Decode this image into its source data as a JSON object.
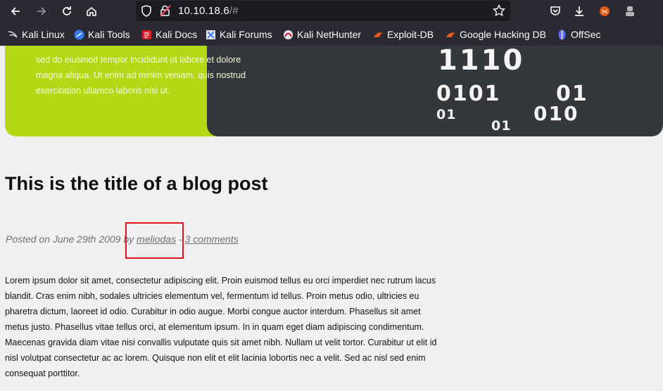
{
  "browser": {
    "url_host": "10.10.18.6",
    "url_path": "/#",
    "nav_icons": [
      "back-icon",
      "forward-icon",
      "reload-icon",
      "home-icon"
    ],
    "url_icons": [
      "shield-icon",
      "insecure-lock-icon",
      "bookmark-star-icon"
    ],
    "toolbar_icons": [
      "pocket-icon",
      "download-icon",
      "extension-icon",
      "account-icon"
    ]
  },
  "bookmarks": [
    {
      "label": "Kali Linux",
      "icon": "kali-dragon-icon"
    },
    {
      "label": "Kali Tools",
      "icon": "kali-tools-icon"
    },
    {
      "label": "Kali Docs",
      "icon": "kali-docs-icon"
    },
    {
      "label": "Kali Forums",
      "icon": "kali-forums-icon"
    },
    {
      "label": "Kali NetHunter",
      "icon": "nethunter-icon"
    },
    {
      "label": "Exploit-DB",
      "icon": "exploit-db-icon"
    },
    {
      "label": "Google Hacking DB",
      "icon": "ghdb-icon"
    },
    {
      "label": "OffSec",
      "icon": "offsec-icon"
    }
  ],
  "hero": {
    "text_lines": [
      "sed do eiusmod tempor incididunt ut labore et dolore",
      "magna aliqua. Ut enim ad minim veniam, quis nostrud",
      "exercitation ullamco laboris nisi ut."
    ],
    "binary": [
      "1110",
      "0101",
      "01",
      "01",
      "010",
      "01"
    ]
  },
  "post": {
    "title": "This is the title of a blog post",
    "meta_prefix": "Posted on June 29th 2009 by ",
    "author": "meliodas",
    "separator": " - ",
    "comments": "3 comments",
    "body": "Lorem ipsum dolor sit amet, consectetur adipiscing elit. Proin euismod tellus eu orci imperdiet nec rutrum lacus blandit. Cras enim nibh, sodales ultricies elementum vel, fermentum id tellus. Proin metus odio, ultricies eu pharetra dictum, laoreet id odio. Curabitur in odio augue. Morbi congue auctor interdum. Phasellus sit amet metus justo. Phasellus vitae tellus orci, at elementum ipsum. In in quam eget diam adipiscing condimentum. Maecenas gravida diam vitae nisi convallis vulputate quis sit amet nibh. Nullam ut velit tortor. Curabitur ut elit id nisl volutpat consectetur ac ac lorem. Quisque non elit et elit lacinia lobortis nec a velit. Sed ac nisl sed enim consequat porttitor."
  },
  "colors": {
    "accent_green": "#b4d816",
    "hero_dark": "#34373b",
    "highlight_red": "#e0121f"
  }
}
